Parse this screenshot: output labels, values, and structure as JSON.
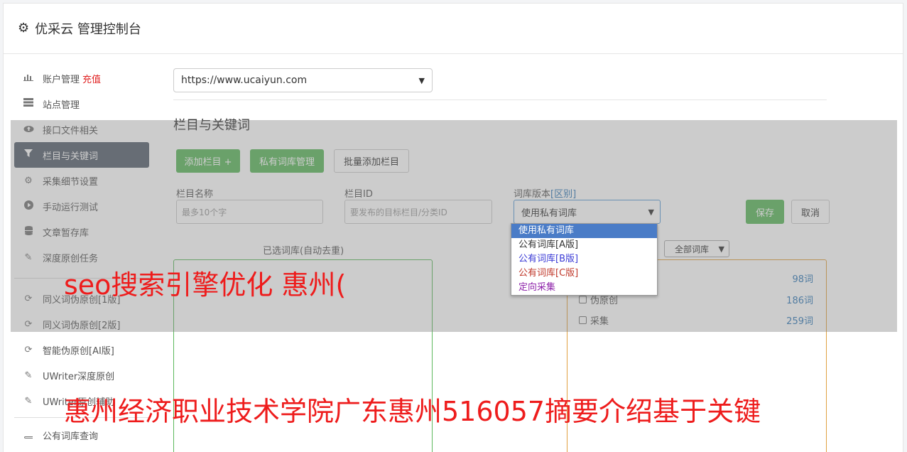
{
  "header": {
    "title": "优采云 管理控制台",
    "icon": "gear-icon"
  },
  "sidebar": {
    "items": [
      {
        "label": "账户管理",
        "badge": "充值",
        "icon": "bar-chart-icon"
      },
      {
        "label": "站点管理",
        "icon": "server-icon"
      },
      {
        "label": "接口文件相关",
        "icon": "cloud-upload-icon"
      },
      {
        "label": "栏目与关键词",
        "icon": "filter-icon",
        "active": true
      },
      {
        "label": "采集细节设置",
        "icon": "cogs-icon"
      },
      {
        "label": "手动运行测试",
        "icon": "play-circle-icon"
      },
      {
        "label": "文章暂存库",
        "icon": "database-icon"
      },
      {
        "label": "深度原创任务",
        "icon": "edit-icon"
      }
    ],
    "items2": [
      {
        "label": "同义词伪原创[1版]",
        "icon": "refresh-icon"
      },
      {
        "label": "同义词伪原创[2版]",
        "icon": "refresh-icon"
      },
      {
        "label": "智能伪原创[AI版]",
        "icon": "refresh-icon"
      },
      {
        "label": "UWriter深度原创",
        "icon": "edit-icon"
      },
      {
        "label": "UWriter原创辅助",
        "icon": "edit-icon"
      }
    ],
    "items3": [
      {
        "label": "公有词库查询",
        "icon": "book-icon"
      }
    ]
  },
  "main": {
    "site_select": "https://www.ucaiyun.com",
    "section_title": "栏目与关键词",
    "buttons": {
      "add_column": "添加栏目 +",
      "private_lib": "私有词库管理",
      "batch_add": "批量添加栏目",
      "save": "保存",
      "cancel": "取消"
    },
    "fields": {
      "column_name_label": "栏目名称",
      "column_name_placeholder": "最多10个字",
      "column_id_label": "栏目ID",
      "column_id_placeholder": "要发布的目标栏目/分类ID",
      "lib_version_label": "词库版本",
      "lib_version_diff": "[区别]",
      "lib_version_value": "使用私有词库"
    },
    "dropdown_options": [
      {
        "label": "使用私有词库",
        "color": "#ffffff"
      },
      {
        "label": "公有词库[A版]",
        "color": "#333333"
      },
      {
        "label": "公有词库[B版]",
        "color": "#3b3bd6"
      },
      {
        "label": "公有词库[C版]",
        "color": "#c0392b"
      },
      {
        "label": "定向采集",
        "color": "#8e24aa"
      }
    ],
    "selected_lib_label": "已选词库(自动去重)",
    "all_libs_select": "全部词库",
    "lib_rows": [
      {
        "label": "",
        "count": "98词"
      },
      {
        "label": "伪原创",
        "count": "186词"
      },
      {
        "label": "采集",
        "count": "259词"
      }
    ]
  },
  "watermarks": {
    "line1": "seo搜索引擎优化 惠州(",
    "line2": "惠州经济职业技术学院广东惠州516057摘要介绍基于关键"
  },
  "colors": {
    "accent_green": "#5cb85c",
    "active_nav": "#58626e",
    "watermark": "#ee1c1c"
  }
}
